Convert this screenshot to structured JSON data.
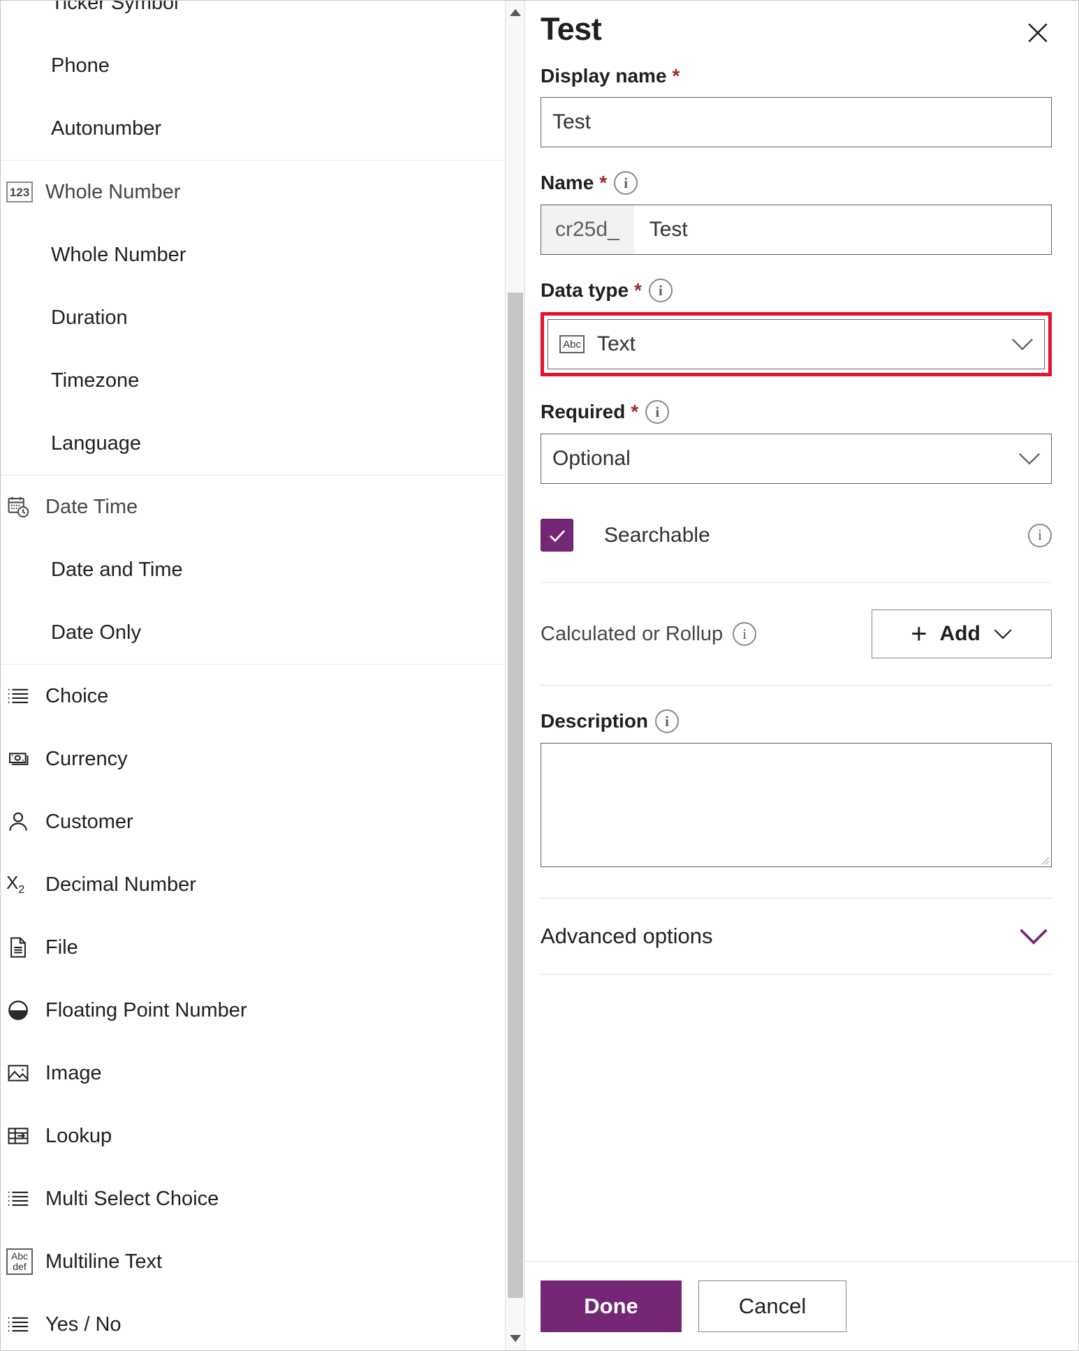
{
  "colors": {
    "accent_purple": "#742774",
    "required_red": "#a4262c",
    "highlight_red": "#e8112d",
    "border_gray": "#605e5c",
    "divider_gray": "#e1dfdd"
  },
  "typelist": {
    "clipped_top_item": "Ticker Symbol",
    "groups": [
      {
        "header": null,
        "header_icon": null,
        "items": [
          {
            "label": "Phone",
            "icon": null
          },
          {
            "label": "Autonumber",
            "icon": null
          }
        ]
      },
      {
        "header": "Whole Number",
        "header_icon": "123-box-icon",
        "items": [
          {
            "label": "Whole Number",
            "icon": null
          },
          {
            "label": "Duration",
            "icon": null
          },
          {
            "label": "Timezone",
            "icon": null
          },
          {
            "label": "Language",
            "icon": null
          }
        ]
      },
      {
        "header": "Date Time",
        "header_icon": "calendar-clock-icon",
        "items": [
          {
            "label": "Date and Time",
            "icon": null
          },
          {
            "label": "Date Only",
            "icon": null
          }
        ]
      },
      {
        "header": null,
        "header_icon": null,
        "items": [
          {
            "label": "Choice",
            "icon": "list-icon"
          },
          {
            "label": "Currency",
            "icon": "money-bill-icon"
          },
          {
            "label": "Customer",
            "icon": "person-icon"
          },
          {
            "label": "Decimal Number",
            "icon": "x-subscript-2-icon"
          },
          {
            "label": "File",
            "icon": "document-icon"
          },
          {
            "label": "Floating Point Number",
            "icon": "half-filled-circle-icon"
          },
          {
            "label": "Image",
            "icon": "picture-icon"
          },
          {
            "label": "Lookup",
            "icon": "table-arrow-icon"
          },
          {
            "label": "Multi Select Choice",
            "icon": "list-icon"
          },
          {
            "label": "Multiline Text",
            "icon": "abc-def-box-icon"
          },
          {
            "label": "Yes / No",
            "icon": "list-icon"
          }
        ]
      }
    ]
  },
  "scrollbar": {
    "up_arrow_icon": "triangle-up-icon",
    "down_arrow_icon": "triangle-down-icon"
  },
  "panel": {
    "title": "Test",
    "close_icon": "close-icon",
    "display_name": {
      "label": "Display name",
      "required_marker": "*",
      "value": "Test"
    },
    "name": {
      "label": "Name",
      "required_marker": "*",
      "info_icon": "info-icon",
      "prefix": "cr25d_",
      "value": "Test"
    },
    "data_type": {
      "label": "Data type",
      "required_marker": "*",
      "info_icon": "info-icon",
      "value": "Text",
      "value_icon": "abc-box-icon",
      "chevron_icon": "chevron-down-icon",
      "highlighted": true
    },
    "required_field": {
      "label": "Required",
      "required_marker": "*",
      "info_icon": "info-icon",
      "value": "Optional",
      "chevron_icon": "chevron-down-icon"
    },
    "searchable": {
      "label": "Searchable",
      "checked": true,
      "check_icon": "checkmark-icon",
      "info_icon": "info-icon"
    },
    "calculated_or_rollup": {
      "label": "Calculated or Rollup",
      "info_icon": "info-icon",
      "add_label": "Add",
      "add_plus_icon": "plus-icon",
      "add_chevron_icon": "chevron-down-icon"
    },
    "description": {
      "label": "Description",
      "info_icon": "info-icon",
      "value": "",
      "resize_grip_icon": "resize-grip-icon"
    },
    "advanced_options": {
      "label": "Advanced options",
      "chevron_icon": "chevron-down-icon"
    },
    "footer": {
      "done_label": "Done",
      "cancel_label": "Cancel"
    }
  }
}
